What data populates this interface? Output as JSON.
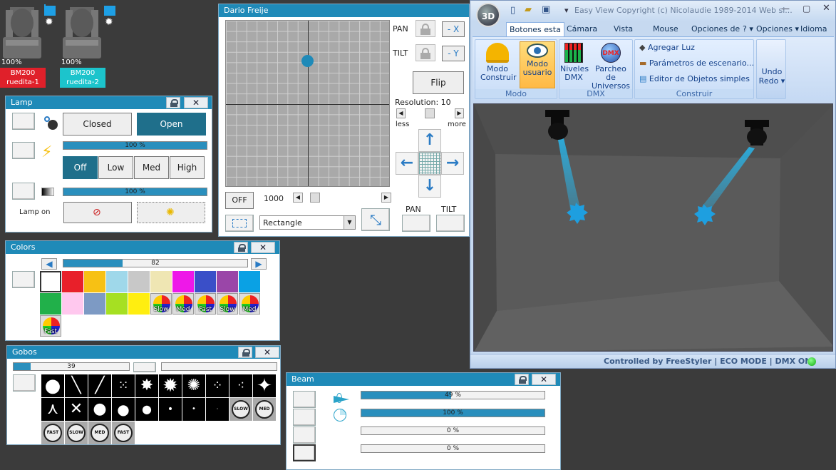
{
  "fixtures": [
    {
      "percent": "100%",
      "model": "BM200",
      "name": "ruedita-1",
      "label_color": "#e0202a"
    },
    {
      "percent": "100%",
      "model": "BM200",
      "name": "ruedita-2",
      "label_color": "#1cc4cc"
    }
  ],
  "lamp": {
    "title": "Lamp",
    "closed": "Closed",
    "open": "Open",
    "bar1": "100 %",
    "bar1_value": 1.0,
    "off": "Off",
    "low": "Low",
    "med": "Med",
    "high": "High",
    "bar2": "100 %",
    "bar2_value": 1.0,
    "lamp_on": "Lamp on"
  },
  "colors": {
    "title": "Colors",
    "value": "82",
    "value_fraction": 0.32,
    "swatches": [
      "#ffffff",
      "#e8202a",
      "#f7c114",
      "#9fd8ea",
      "#c8c8c8",
      "#efe6b3",
      "#ee18e8",
      "#3a4fc8",
      "#9a46a8",
      "#0aa1e4",
      "#21b04a",
      "#ffc8ee",
      "#7d9ac4",
      "#a6e022",
      "#ffee10"
    ],
    "wheels": [
      "Slow",
      "Med",
      "Fast",
      "Slow",
      "Med",
      "Fast"
    ]
  },
  "gobos": {
    "title": "Gobos",
    "value": "39",
    "value_fraction": 0.15,
    "speeds": [
      "SLOW",
      "MED",
      "FAST",
      "SLOW",
      "MED",
      "FAST"
    ]
  },
  "beam": {
    "title": "Beam",
    "bars": [
      {
        "label": "49 %",
        "value": 0.49
      },
      {
        "label": "100 %",
        "value": 1.0
      },
      {
        "label": "0 %",
        "value": 0
      },
      {
        "label": "0 %",
        "value": 0
      }
    ]
  },
  "pantilt": {
    "title": "Dario Freije",
    "pan": "PAN",
    "tilt": "TILT",
    "minus_x": "- X",
    "minus_y": "- Y",
    "flip": "Flip",
    "resolution": "Resolution: 10",
    "less": "less",
    "more": "more",
    "off": "OFF",
    "speed": "1000",
    "shape": "Rectangle",
    "pan_label": "PAN",
    "tilt_label": "TILT"
  },
  "viewer": {
    "title": "Easy View   Copyright (c) Nicolaudie 1989-2014   Web si...",
    "tabs": [
      "Botones esta",
      "Cámara",
      "Vista",
      "Mouse",
      "Opciones de"
    ],
    "help": "? ▾",
    "options": "Opciones ▾",
    "language": "Idioma ▾",
    "modo_construir": "Modo Construir",
    "modo_usuario": "Modo usuario",
    "group_modo": "Modo",
    "niveles_dmx": "Niveles DMX",
    "parcheo": "Parcheo de Universos",
    "group_dmx": "DMX",
    "agregar_luz": "Agregar Luz",
    "parametros": "Parámetros de escenario...",
    "editor": "Editor de Objetos simples",
    "group_construir": "Construir",
    "undo": "Undo",
    "redo": "Redo ▾",
    "status": "Controlled by FreeStyler   |   ECO MODE   |   DMX ON",
    "accent": "#1f8ab8"
  }
}
